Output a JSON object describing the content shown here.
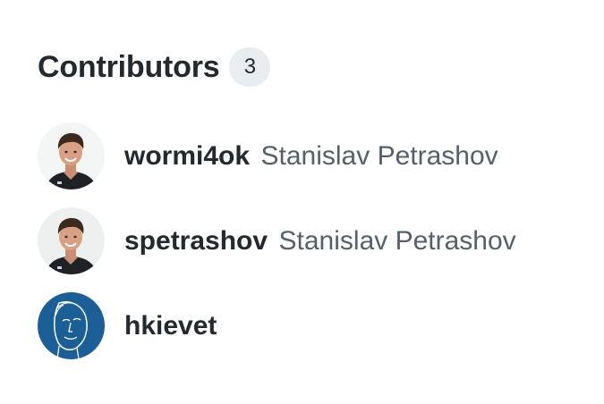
{
  "contributors": {
    "title": "Contributors",
    "count": "3",
    "items": [
      {
        "login": "wormi4ok",
        "name": "Stanislav Petrashov",
        "avatar_icon": "person-photo"
      },
      {
        "login": "spetrashov",
        "name": "Stanislav Petrashov",
        "avatar_icon": "person-photo"
      },
      {
        "login": "hkievet",
        "name": "",
        "avatar_icon": "line-drawing-face"
      }
    ]
  },
  "colors": {
    "text": "#24292f",
    "muted": "#57606a",
    "counter_bg": "#eaedf0",
    "avatar_blue": "#1b5f96"
  }
}
